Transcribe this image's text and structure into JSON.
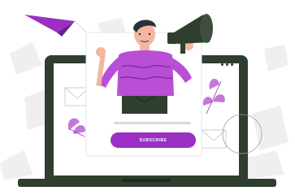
{
  "illustration": {
    "subscribe_label": "SUBSCRIBE",
    "palette": {
      "accent": "#9b2fc4",
      "accent_light": "#c27ad8",
      "laptop_frame": "#2f3e2f",
      "screen_bg": "#ffffff",
      "background_shapes": "#efefef",
      "shirt": "#b94fd6",
      "skin": "#f4b6a0",
      "hair": "#263238",
      "megaphone": "#2f3e2f"
    }
  }
}
